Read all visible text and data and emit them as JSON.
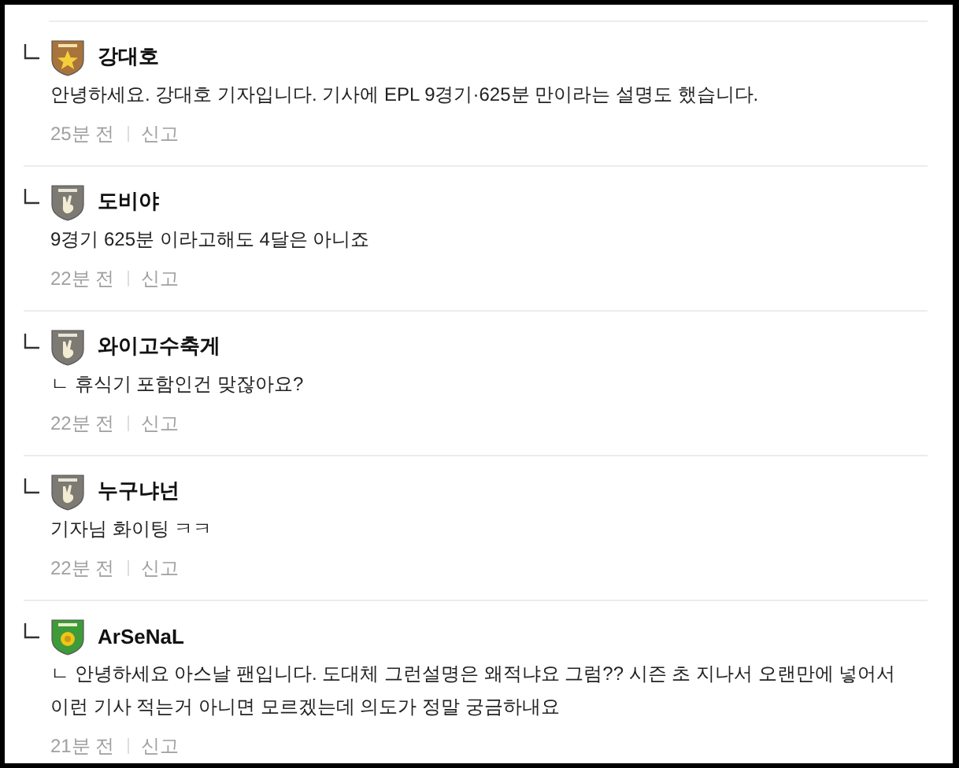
{
  "comments": [
    {
      "author": "강대호",
      "badge": {
        "kind": "star"
      },
      "body": [
        "안녕하세요. 강대호 기자입니다. 기사에 EPL 9경기·625분 만이라는 설명도 했습니다."
      ],
      "time": "25분 전",
      "report": "신고"
    },
    {
      "author": "도비야",
      "badge": {
        "kind": "hand"
      },
      "body": [
        "9경기 625분 이라고해도 4달은 아니죠"
      ],
      "time": "22분 전",
      "report": "신고"
    },
    {
      "author": "와이고수축게",
      "badge": {
        "kind": "hand"
      },
      "body": [
        "ㄴ 휴식기 포함인건 맞잖아요?"
      ],
      "time": "22분 전",
      "report": "신고"
    },
    {
      "author": "누구냐넌",
      "badge": {
        "kind": "hand"
      },
      "body": [
        "기자님 화이팅 ㅋㅋ"
      ],
      "time": "22분 전",
      "report": "신고"
    },
    {
      "author": "ArSeNaL",
      "badge": {
        "kind": "medal"
      },
      "body": [
        "ㄴ 안녕하세요 아스날 팬입니다. 도대체 그런설명은 왜적냐요 그럼?? 시즌 초 지나서 오랜만에 넣어서",
        "이런 기사 적는거 아니면 모르겠는데 의도가 정말 궁금하내요"
      ],
      "time": "21분 전",
      "report": "신고"
    }
  ]
}
